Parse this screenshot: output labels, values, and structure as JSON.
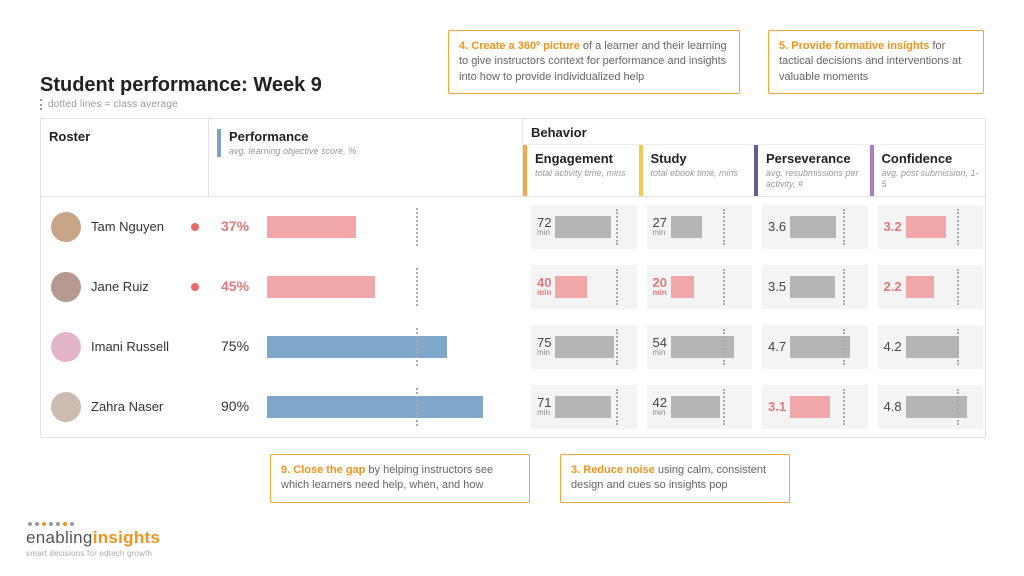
{
  "header": {
    "title": "Student performance: Week 9",
    "subtitle": "dotted lines = class average"
  },
  "columns": {
    "roster": "Roster",
    "performance": {
      "label": "Performance",
      "sub": "avg. learning objective score, %"
    },
    "behavior_label": "Behavior",
    "behavior": {
      "engagement": {
        "label": "Engagement",
        "sub": "total activity time, mins"
      },
      "study": {
        "label": "Study",
        "sub": "total ebook time, mins"
      },
      "perseverance": {
        "label": "Perseverance",
        "sub": "avg. resubmissions per activity, #"
      },
      "confidence": {
        "label": "Confidence",
        "sub": "avg. post submission, 1-5"
      }
    }
  },
  "students": [
    {
      "name": "Tam Nguyen",
      "flag": true,
      "perf": 37,
      "engagement": 72,
      "study": 27,
      "perseverance": 3.6,
      "confidence": 3.2,
      "low": {
        "perf": true,
        "engagement": false,
        "study": false,
        "perseverance": false,
        "confidence": true
      }
    },
    {
      "name": "Jane Ruiz",
      "flag": true,
      "perf": 45,
      "engagement": 40,
      "study": 20,
      "perseverance": 3.5,
      "confidence": 2.2,
      "low": {
        "perf": true,
        "engagement": true,
        "study": true,
        "perseverance": false,
        "confidence": true
      }
    },
    {
      "name": "Imani Russell",
      "flag": false,
      "perf": 75,
      "engagement": 75,
      "study": 54,
      "perseverance": 4.7,
      "confidence": 4.2,
      "low": {
        "perf": false,
        "engagement": false,
        "study": false,
        "perseverance": false,
        "confidence": false
      }
    },
    {
      "name": "Zahra Naser",
      "flag": false,
      "perf": 90,
      "engagement": 71,
      "study": 42,
      "perseverance": 3.1,
      "confidence": 4.8,
      "low": {
        "perf": false,
        "engagement": false,
        "study": false,
        "perseverance": true,
        "confidence": false
      }
    }
  ],
  "averages": {
    "perf": 62,
    "engagement": 65,
    "study": 36,
    "perseverance": 3.7,
    "confidence": 3.6
  },
  "callouts": {
    "c4": {
      "num": "4.",
      "lead": "Create a 360º picture",
      "rest": " of a learner and their learning to give instructors context for performance and insights into how to provide individualized help"
    },
    "c5": {
      "num": "5.",
      "lead": "Provide formative insights",
      "rest": " for tactical decisions and interventions at valuable moments"
    },
    "c9": {
      "num": "9.",
      "lead": "Close the gap",
      "rest": " by helping instructors see which learners need help, when, and how"
    },
    "c3": {
      "num": "3.",
      "lead": "Reduce noise",
      "rest": " using calm, consistent design and cues so insights pop"
    }
  },
  "logo": {
    "word1": "enabling",
    "word2": "insights",
    "tag": "smart decisions for edtech growth"
  },
  "avatar_colors": [
    "#c7a586",
    "#b6998f",
    "#e4b5c9",
    "#cdbab0"
  ],
  "chart_data": {
    "type": "table",
    "title": "Student performance: Week 9",
    "columns": [
      "Student",
      "Performance %",
      "Engagement (min)",
      "Study (min)",
      "Perseverance (#)",
      "Confidence (1-5)"
    ],
    "rows": [
      [
        "Tam Nguyen",
        37,
        72,
        27,
        3.6,
        3.2
      ],
      [
        "Jane Ruiz",
        45,
        40,
        20,
        3.5,
        2.2
      ],
      [
        "Imani Russell",
        75,
        75,
        54,
        4.7,
        4.2
      ],
      [
        "Zahra Naser",
        90,
        71,
        42,
        3.1,
        4.8
      ]
    ],
    "class_average": {
      "Performance %": 62,
      "Engagement (min)": 65,
      "Study (min)": 36,
      "Perseverance (#)": 3.7,
      "Confidence (1-5)": 3.6
    }
  }
}
